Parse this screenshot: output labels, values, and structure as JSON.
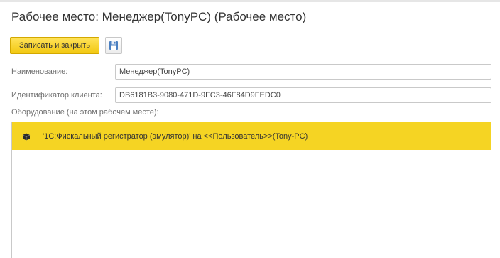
{
  "window": {
    "title": "Рабочее место: Менеджер(TonyPC) (Рабочее место)"
  },
  "toolbar": {
    "save_close_label": "Записать и закрыть",
    "save_icon": "floppy-disk-icon"
  },
  "form": {
    "name_label": "Наименование:",
    "name_value": "Менеджер(TonyPC)",
    "client_id_label": "Идентификатор клиента:",
    "client_id_value": "DB6181B3-9080-471D-9FC3-46F84D9FEDC0"
  },
  "equipment": {
    "label": "Оборудование (на этом рабочем месте):",
    "items": [
      {
        "icon": "fiscal-register-icon",
        "text": "'1С:Фискальный регистратор (эмулятор)' на <<Пользователь>>(Tony-PC)",
        "selected": true
      }
    ]
  },
  "colors": {
    "accent": "#f5d423",
    "button_yellow": "#f2c811"
  }
}
